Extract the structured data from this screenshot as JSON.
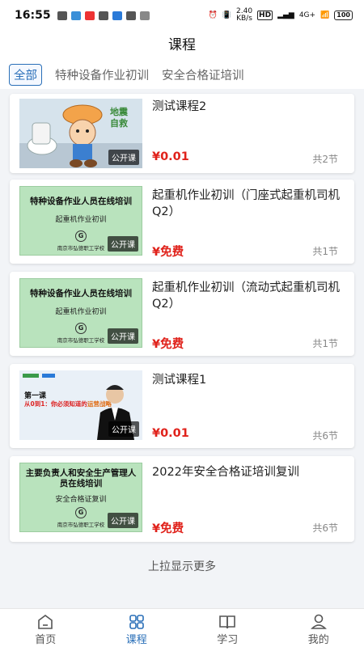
{
  "status": {
    "time": "16:55",
    "net_speed": "2.40",
    "net_unit": "KB/s",
    "battery": "100",
    "net": "4G+"
  },
  "header": {
    "title": "课程"
  },
  "tabs": [
    {
      "label": "全部",
      "active": true
    },
    {
      "label": "特种设备作业初训",
      "active": false
    },
    {
      "label": "安全合格证培训",
      "active": false
    }
  ],
  "courses": [
    {
      "title": "测试课程2",
      "price": "¥0.01",
      "lessons": "共2节",
      "badge": "公开课",
      "thumb": {
        "kind": "cartoon"
      }
    },
    {
      "title": "起重机作业初训（门座式起重机司机Q2）",
      "price": "¥免费",
      "lessons": "共1节",
      "badge": "公开课",
      "thumb": {
        "kind": "green",
        "line1": "特种设备作业人员在线培训",
        "line2": "起重机作业初训",
        "logo": "G",
        "school": "南京市弘德职工学校"
      }
    },
    {
      "title": "起重机作业初训（流动式起重机司机Q2）",
      "price": "¥免费",
      "lessons": "共1节",
      "badge": "公开课",
      "thumb": {
        "kind": "green",
        "line1": "特种设备作业人员在线培训",
        "line2": "起重机作业初训",
        "logo": "G",
        "school": "南京市弘德职工学校"
      }
    },
    {
      "title": "测试课程1",
      "price": "¥0.01",
      "lessons": "共6节",
      "badge": "公开课",
      "thumb": {
        "kind": "lecture",
        "line1": "第一课",
        "line2": "从0到1：你必须知道的",
        "line3": "运营战略"
      }
    },
    {
      "title": "2022年安全合格证培训复训",
      "price": "¥免费",
      "lessons": "共6节",
      "badge": "公开课",
      "thumb": {
        "kind": "green",
        "line1": "主要负责人和安全生产管理人员在线培训",
        "line2": "安全合格证复训",
        "logo": "G",
        "school": "南京市弘德职工学校"
      }
    }
  ],
  "load_more": "上拉显示更多",
  "nav": [
    {
      "label": "首页",
      "icon": "home-icon"
    },
    {
      "label": "课程",
      "icon": "grid-icon",
      "active": true
    },
    {
      "label": "学习",
      "icon": "book-icon"
    },
    {
      "label": "我的",
      "icon": "user-icon"
    }
  ],
  "colors": {
    "accent": "#2a6fb8",
    "price": "#e0221b",
    "thumb_green": "#b9e3bd"
  }
}
